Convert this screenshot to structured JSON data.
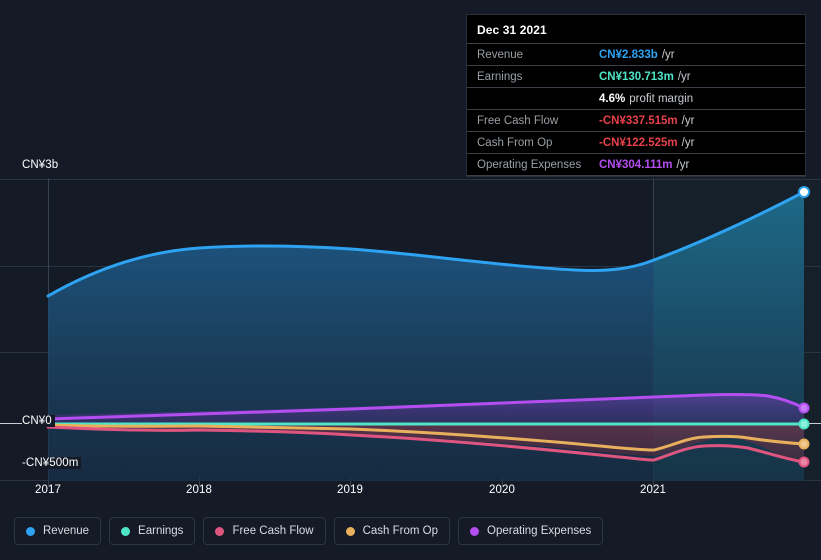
{
  "chart_data": {
    "type": "area",
    "title": "",
    "xlabel": "",
    "ylabel": "",
    "currency": "CN¥",
    "x": [
      2017.0,
      2017.5,
      2018.0,
      2018.5,
      2019.0,
      2019.5,
      2020.0,
      2020.5,
      2021.0,
      2021.5,
      2021.9
    ],
    "xlim": [
      2016.87,
      2022.0
    ],
    "ylim": [
      -700000000,
      3350000000
    ],
    "grid": true,
    "legend_position": "bottom-left",
    "y_ticks": [
      {
        "value": 3000000000,
        "label": "CN¥3b"
      },
      {
        "value": 0,
        "label": "CN¥0"
      },
      {
        "value": -500000000,
        "label": "-CN¥500m"
      }
    ],
    "x_ticks": [
      {
        "value": 2017,
        "label": "2017"
      },
      {
        "value": 2018,
        "label": "2018"
      },
      {
        "value": 2019,
        "label": "2019"
      },
      {
        "value": 2020,
        "label": "2020"
      },
      {
        "value": 2021,
        "label": "2021"
      }
    ],
    "series": [
      {
        "name": "Revenue",
        "color": "#2ea3f2",
        "filled": true,
        "values": [
          1480000000,
          1840000000,
          2120000000,
          2160000000,
          2150000000,
          2080000000,
          2030000000,
          2090000000,
          2260000000,
          2580000000,
          2833000000
        ]
      },
      {
        "name": "Earnings",
        "color": "#4fe6c8",
        "filled": false,
        "values": [
          55000000,
          58000000,
          62000000,
          60000000,
          56000000,
          52000000,
          50000000,
          52000000,
          58000000,
          95000000,
          130713000
        ]
      },
      {
        "name": "Free Cash Flow",
        "color": "#e0557f",
        "filled": false,
        "values": [
          -20000000,
          -45000000,
          -40000000,
          -35000000,
          -60000000,
          -110000000,
          -160000000,
          -180000000,
          -95000000,
          -260000000,
          -337515000
        ]
      },
      {
        "name": "Cash From Op",
        "color": "#e8b05c",
        "filled": false,
        "values": [
          30000000,
          15000000,
          20000000,
          25000000,
          5000000,
          -45000000,
          -95000000,
          -120000000,
          -15000000,
          -90000000,
          -122525000
        ]
      },
      {
        "name": "Operating Expenses",
        "color": "#b44ef0",
        "filled": false,
        "values": [
          95000000,
          110000000,
          130000000,
          145000000,
          160000000,
          180000000,
          200000000,
          215000000,
          235000000,
          270000000,
          304111000
        ]
      }
    ]
  },
  "tooltip": {
    "title": "Dec 31 2021",
    "rows": [
      {
        "key": "Revenue",
        "value": "CN¥2.833b",
        "unit": "/yr",
        "color": "#2ea3f2"
      },
      {
        "key": "Earnings",
        "value": "CN¥130.713m",
        "unit": "/yr",
        "color": "#4fe6c8"
      },
      {
        "key": "",
        "value": "4.6%",
        "unit": "profit margin",
        "color": "#ffffff",
        "sub": true
      },
      {
        "key": "Free Cash Flow",
        "value": "-CN¥337.515m",
        "unit": "/yr",
        "color": "#e8424a"
      },
      {
        "key": "Cash From Op",
        "value": "-CN¥122.525m",
        "unit": "/yr",
        "color": "#e8424a"
      },
      {
        "key": "Operating Expenses",
        "value": "CN¥304.111m",
        "unit": "/yr",
        "color": "#b44ef0"
      }
    ]
  },
  "legend": {
    "items": [
      {
        "label": "Revenue",
        "color": "#2ea3f2"
      },
      {
        "label": "Earnings",
        "color": "#4fe6c8"
      },
      {
        "label": "Free Cash Flow",
        "color": "#e0557f"
      },
      {
        "label": "Cash From Op",
        "color": "#e8b05c"
      },
      {
        "label": "Operating Expenses",
        "color": "#b44ef0"
      }
    ]
  }
}
